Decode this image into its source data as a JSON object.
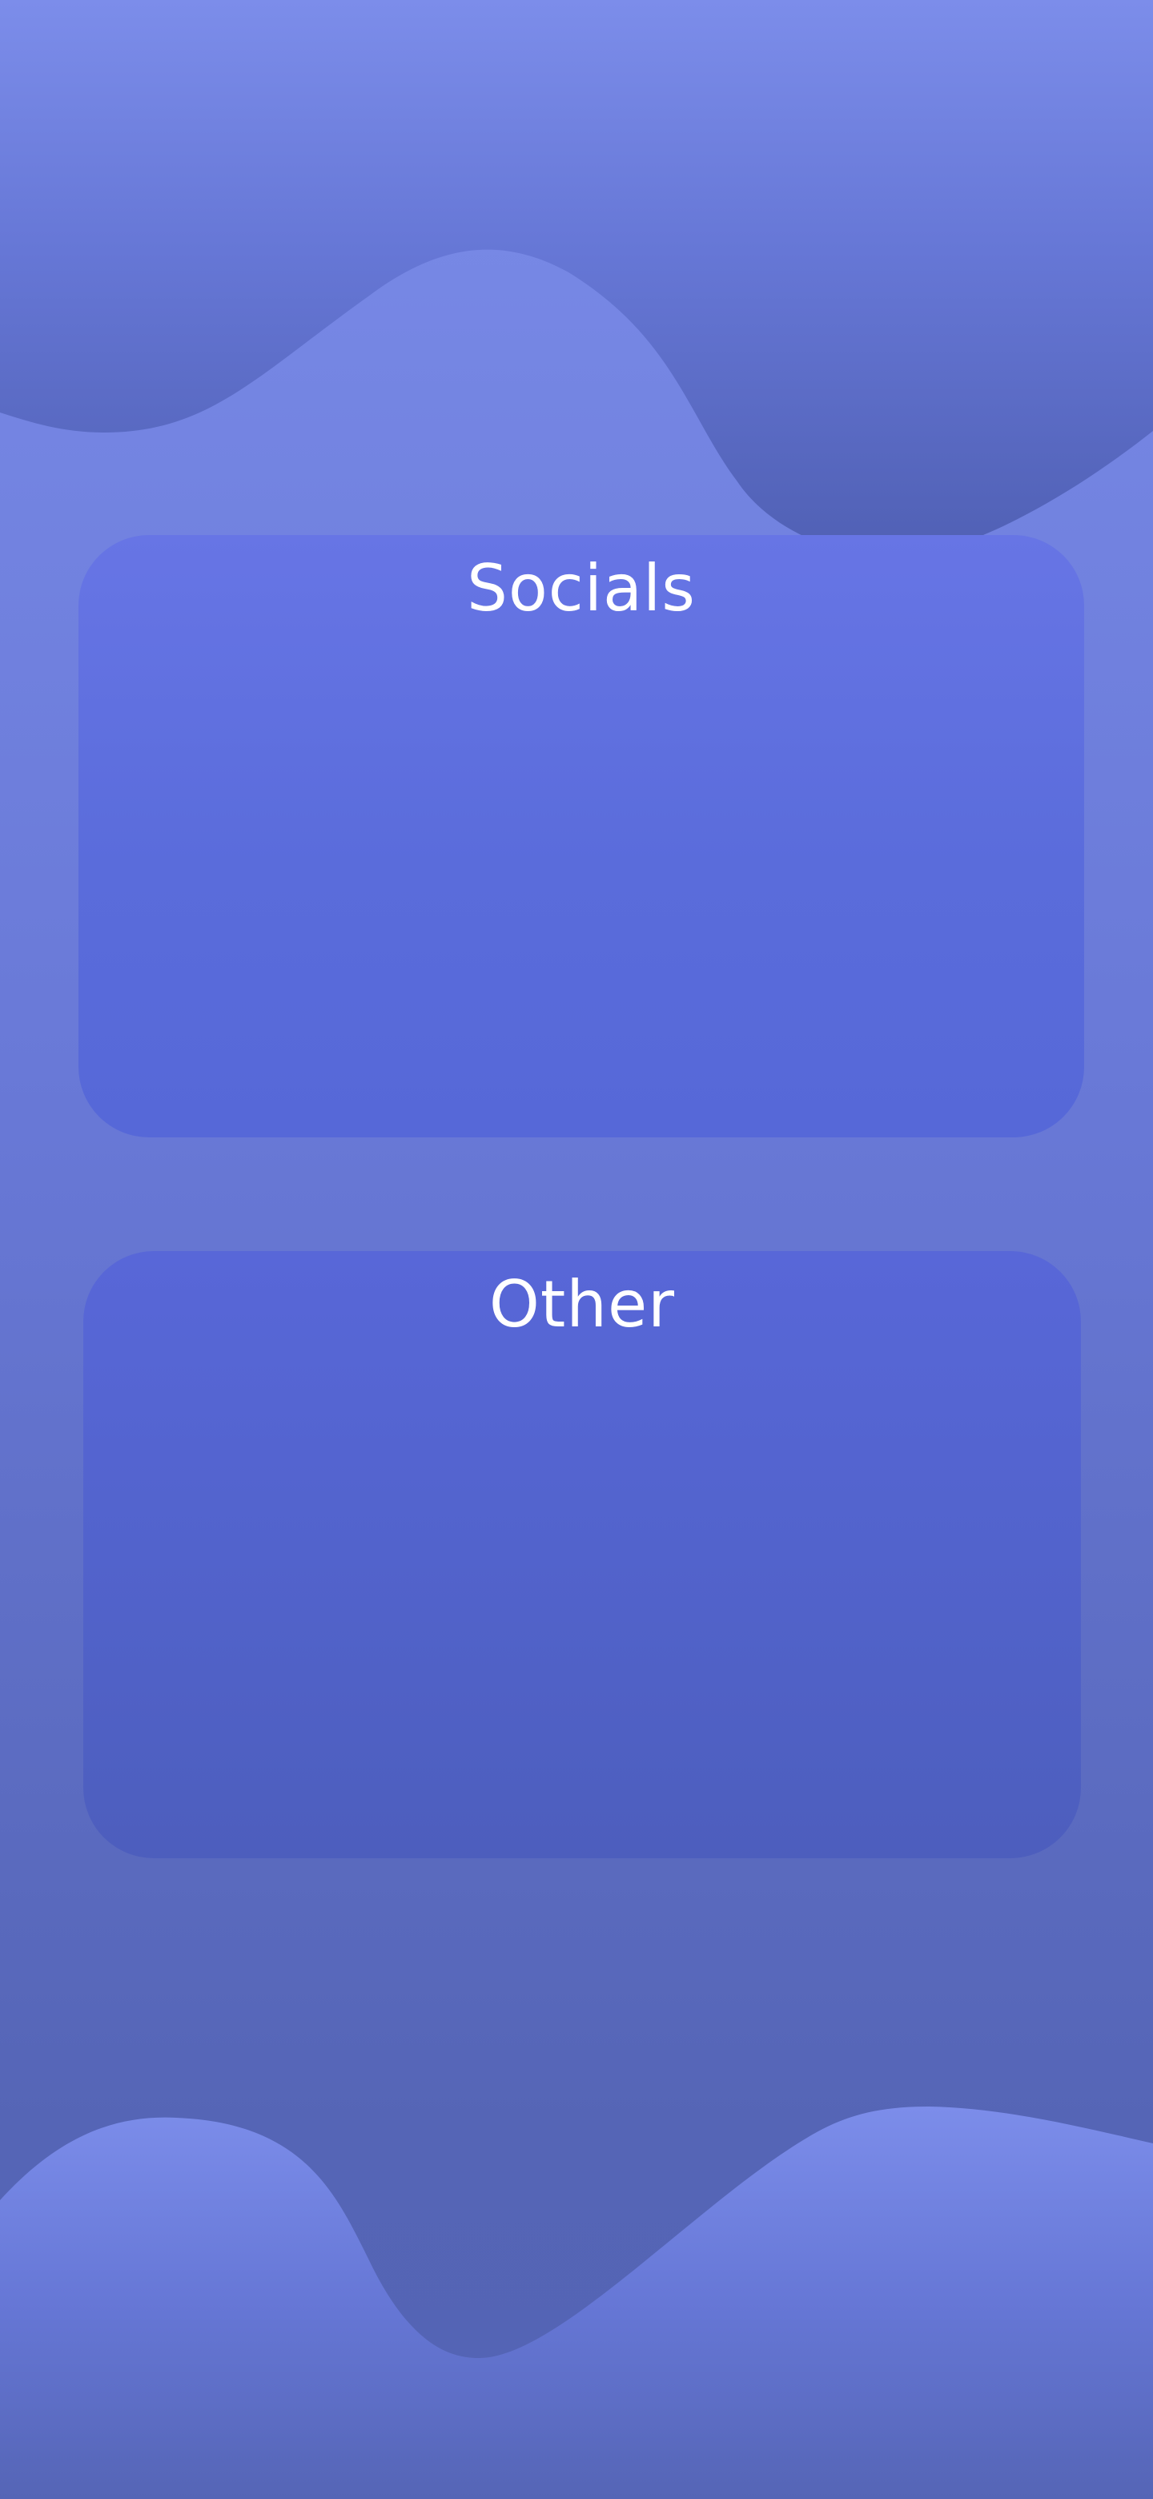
{
  "sections": [
    {
      "title": "Socials"
    },
    {
      "title": "Other"
    }
  ],
  "colors": {
    "background_top": "#7b8ce9",
    "background_bottom": "#5464b4",
    "wave_dark": "#5565b6",
    "wave_light": "#7b8ce9",
    "card_socials": "#5f70e0",
    "card_other": "#5263cc",
    "title_text": "#ffffff"
  }
}
